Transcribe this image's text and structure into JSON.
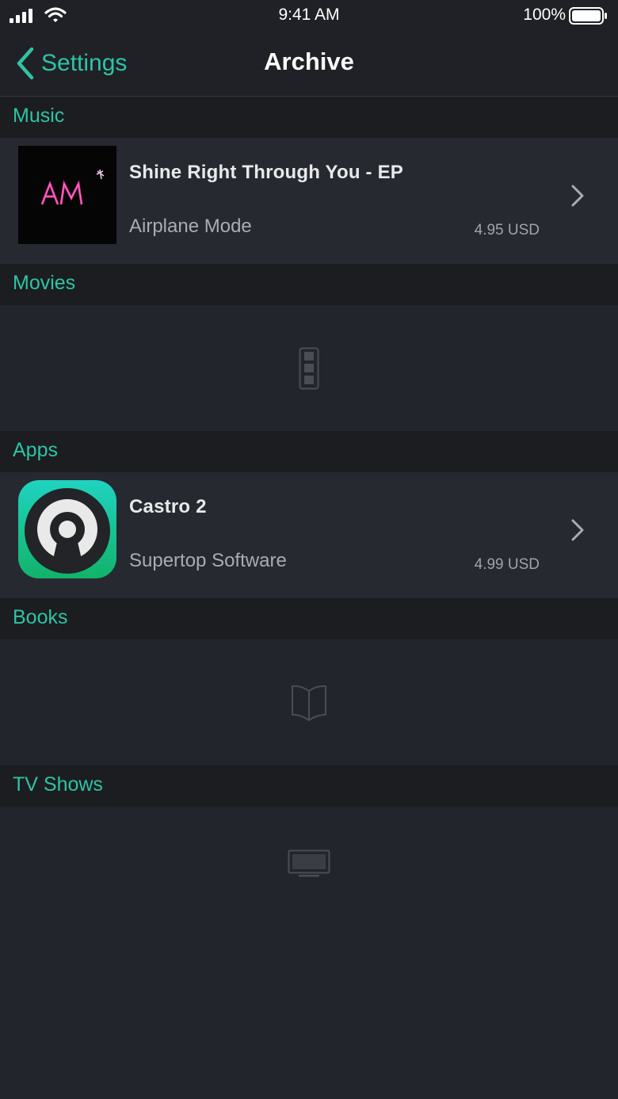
{
  "status_bar": {
    "time": "9:41 AM",
    "battery_percent": "100%"
  },
  "nav": {
    "back_label": "Settings",
    "title": "Archive"
  },
  "colors": {
    "accent": "#2ec4a3",
    "background": "#22252b",
    "header_background": "#1b1d21"
  },
  "sections": {
    "music": {
      "header": "Music",
      "item": {
        "title": "Shine Right Through You - EP",
        "subtitle": "Airplane Mode",
        "price": "4.95 USD",
        "art_text": "AM"
      }
    },
    "movies": {
      "header": "Movies",
      "placeholder_icon": "film-strip-icon"
    },
    "apps": {
      "header": "Apps",
      "item": {
        "title": "Castro 2",
        "subtitle": "Supertop Software",
        "price": "4.99 USD"
      }
    },
    "books": {
      "header": "Books",
      "placeholder_icon": "open-book-icon"
    },
    "tv_shows": {
      "header": "TV Shows",
      "placeholder_icon": "tv-icon"
    }
  }
}
